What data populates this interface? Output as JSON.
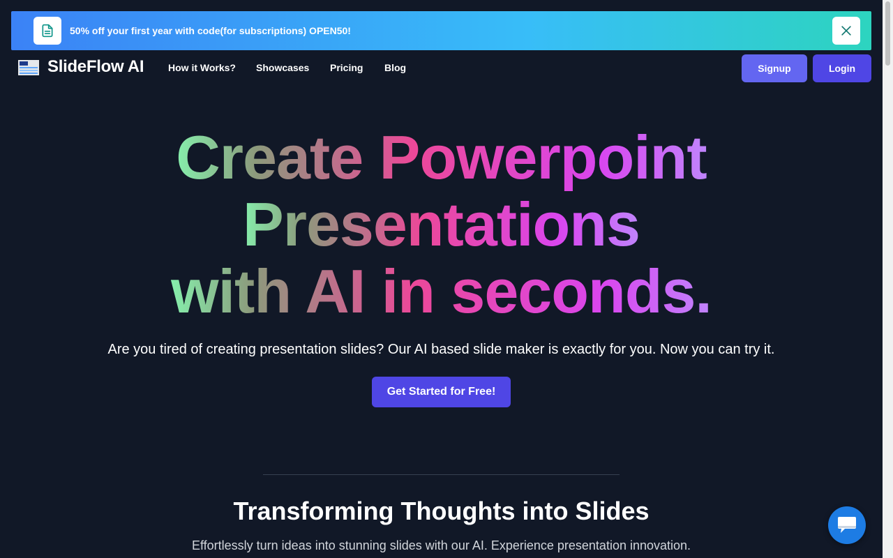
{
  "banner": {
    "icon": "document-icon",
    "text": "50% off your first year with code(for subscriptions) OPEN50!",
    "close_icon": "close-icon"
  },
  "nav": {
    "logo_text": "SlideFlow AI",
    "links": [
      "How it Works?",
      "Showcases",
      "Pricing",
      "Blog"
    ],
    "signup_label": "Signup",
    "login_label": "Login"
  },
  "hero": {
    "title_line1": "Create Powerpoint",
    "title_line2": "Presentations",
    "title_line3": "with AI in seconds.",
    "subtitle": "Are you tired of creating presentation slides? Our AI based slide maker is exactly for you. Now you can try it.",
    "cta_label": "Get Started for Free!"
  },
  "section": {
    "title": "Transforming Thoughts into Slides",
    "subtitle": "Effortlessly turn ideas into stunning slides with our AI. Experience presentation innovation."
  },
  "chat": {
    "icon": "chat-bubble-icon"
  },
  "colors": {
    "background": "#111827",
    "accent": "#4f46e5",
    "signup": "#6366f1",
    "chat": "#1d7ce4"
  }
}
